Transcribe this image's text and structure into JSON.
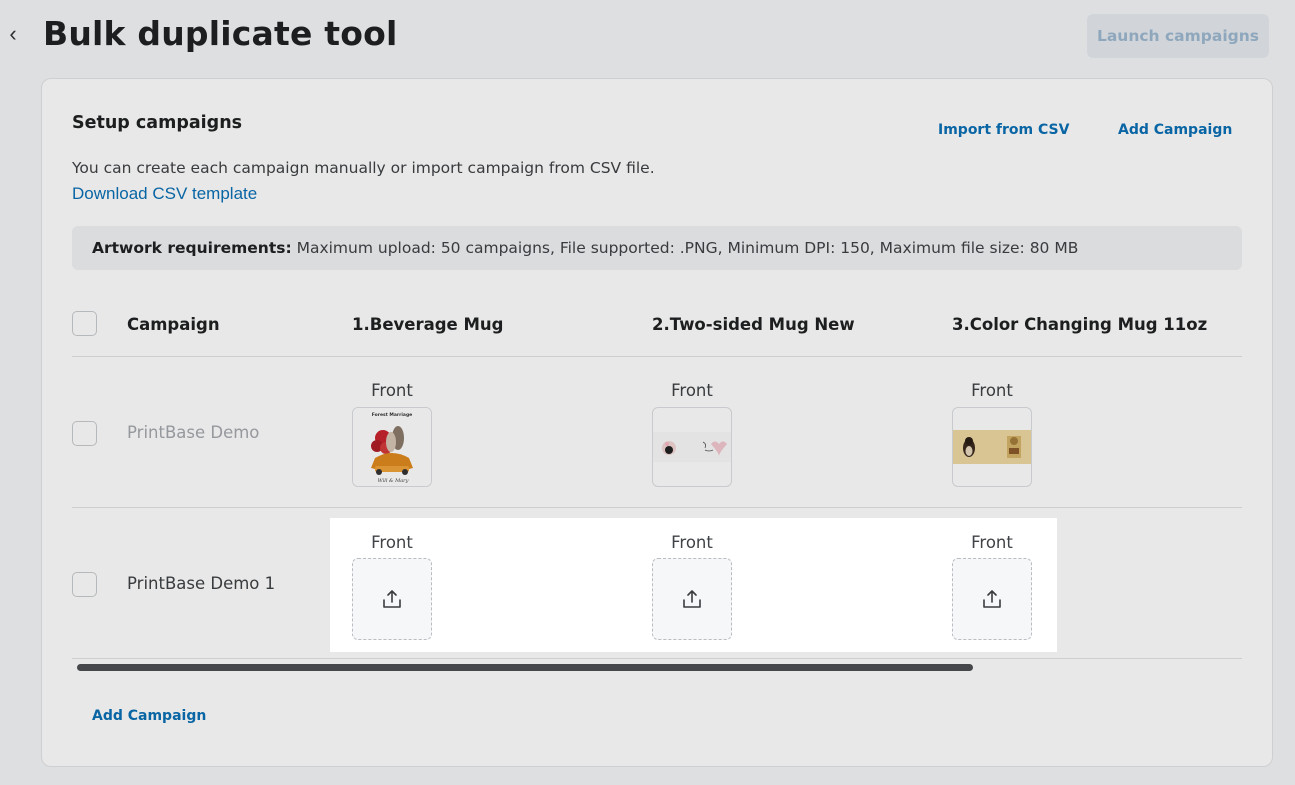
{
  "header": {
    "back_glyph": "‹",
    "title": "Bulk duplicate tool",
    "launch_label": "Launch campaigns"
  },
  "setup": {
    "title": "Setup campaigns",
    "import_label": "Import from CSV",
    "add_label": "Add Campaign",
    "description": "You can create each campaign manually or import campaign from CSV file.",
    "csv_template_link": "Download CSV template",
    "requirements_label": "Artwork requirements:",
    "requirements_text": " Maximum upload: 50 campaigns, File supported: .PNG, Minimum DPI: 150, Maximum file size: 80 MB"
  },
  "table": {
    "columns": [
      "Campaign",
      "1.Beverage Mug",
      "2.Two-sided Mug New",
      "3.Color Changing Mug 11oz"
    ],
    "rows": [
      {
        "name": "PrintBase Demo",
        "side_labels": [
          "Front",
          "Front",
          "Front"
        ]
      },
      {
        "name": "PrintBase Demo 1",
        "side_labels": [
          "Front",
          "Front",
          "Front"
        ]
      }
    ]
  },
  "thumbnails": {
    "mug1_caption": "Forest Marriage",
    "mug1_signature": "Will & Mary"
  },
  "footer": {
    "add_campaign_label": "Add Campaign"
  },
  "colors": {
    "link": "#0a6fb5",
    "launch_button_bg": "#e6ebf0",
    "launch_button_text": "#9db8cf",
    "page_bg": "#f4f6f8"
  },
  "icons": {
    "back": "chevron-left-icon",
    "upload": "upload-icon"
  }
}
